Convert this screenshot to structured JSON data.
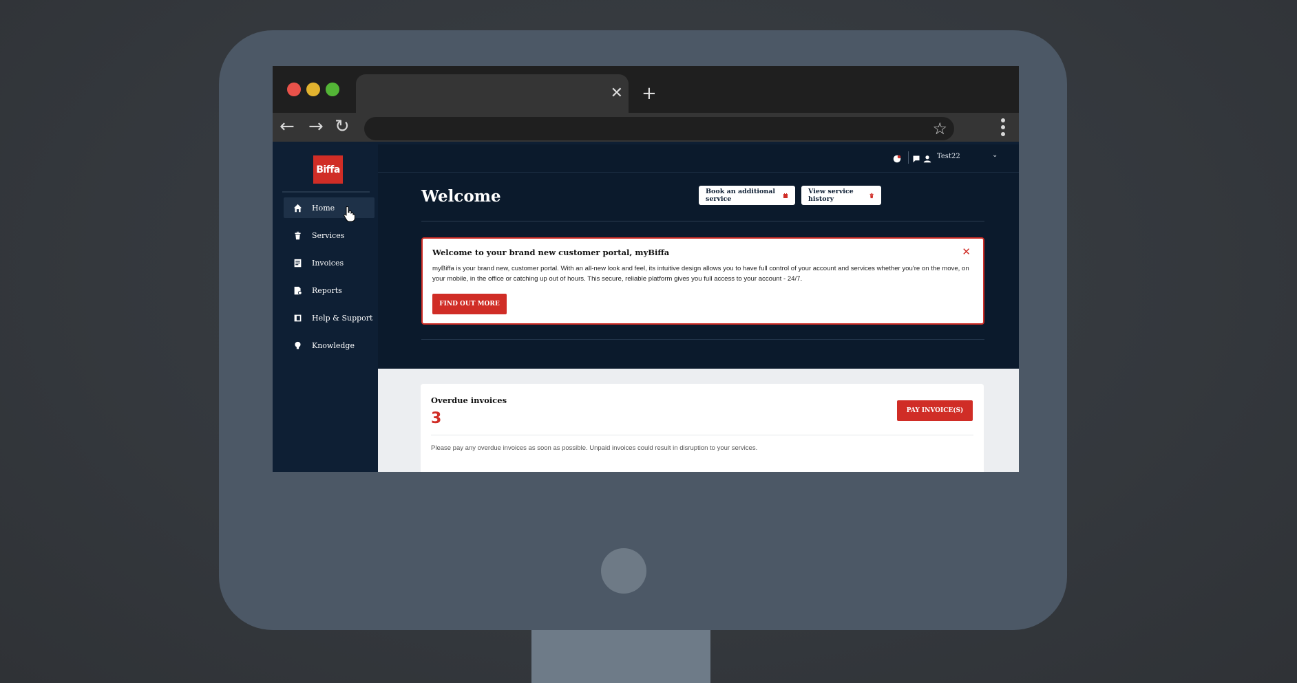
{
  "browser": {
    "tab_close": "✕",
    "tab_new": "+",
    "nav_back": "←",
    "nav_forward": "→",
    "nav_reload": "↻",
    "star": "☆"
  },
  "brand": {
    "logo_text": "Biffa",
    "accent": "#d02d26"
  },
  "sidebar": {
    "items": [
      {
        "label": "Home",
        "icon": "home-icon"
      },
      {
        "label": "Services",
        "icon": "bin-icon"
      },
      {
        "label": "Invoices",
        "icon": "invoice-icon"
      },
      {
        "label": "Reports",
        "icon": "report-icon"
      },
      {
        "label": "Help & Support",
        "icon": "help-icon"
      },
      {
        "label": "Knowledge",
        "icon": "lightbulb-icon"
      }
    ]
  },
  "topbar": {
    "user_name": "Test22",
    "chevron": "⌄"
  },
  "header": {
    "title": "Welcome",
    "book_button": "Book an additional service",
    "history_button": "View service history"
  },
  "alert": {
    "title": "Welcome to your brand new customer portal, myBiffa",
    "close": "✕",
    "body": "myBiffa is your brand new, customer portal. With an all-new look and feel, its intuitive design allows you to have full control of your account and services whether you're on the move, on your mobile, in the office or catching up out of hours. This secure, reliable platform gives you full access to your account - 24/7.",
    "button": "FIND OUT MORE"
  },
  "overdue": {
    "title": "Overdue invoices",
    "count": "3",
    "button": "PAY INVOICE(S)",
    "note": "Please pay any overdue invoices as soon as possible. Unpaid invoices could result in disruption to your services."
  }
}
